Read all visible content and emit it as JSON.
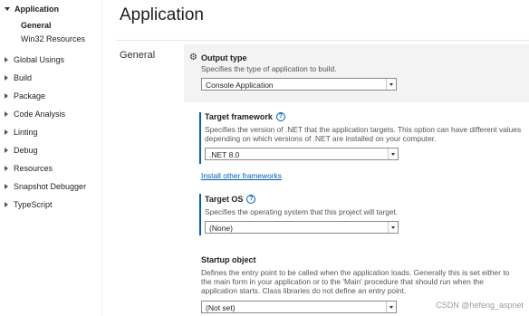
{
  "sidebar": {
    "application": {
      "label": "Application",
      "children": [
        "General",
        "Win32 Resources"
      ]
    },
    "items": [
      "Global Usings",
      "Build",
      "Package",
      "Code Analysis",
      "Linting",
      "Debug",
      "Resources",
      "Snapshot Debugger",
      "TypeScript"
    ]
  },
  "main": {
    "title": "Application",
    "section": "General",
    "properties": {
      "output_type": {
        "title": "Output type",
        "description": "Specifies the type of application to build.",
        "value": "Console Application"
      },
      "target_framework": {
        "title": "Target framework",
        "description_line1": "Specifies the version of .NET that the application targets. This option can have different values",
        "description_line2": "depending on which versions of .NET are installed on your computer.",
        "value": ".NET 8.0",
        "link": "Install other frameworks"
      },
      "target_os": {
        "title": "Target OS",
        "description": "Specifies the operating system that this project will target.",
        "value": "(None)"
      },
      "startup_object": {
        "title": "Startup object",
        "description_line1": "Defines the entry point to be called when the application loads. Generally this is set either to",
        "description_line2": "the main form in your application or to the 'Main' procedure that should run when the",
        "description_line3": "application starts. Class libraries do not define an entry point.",
        "value": "(Not set)"
      }
    }
  },
  "watermark": "CSDN @hefeng_aspnet",
  "colors": {
    "accent": "#005fb8",
    "card_bg": "#f3f3f3"
  }
}
